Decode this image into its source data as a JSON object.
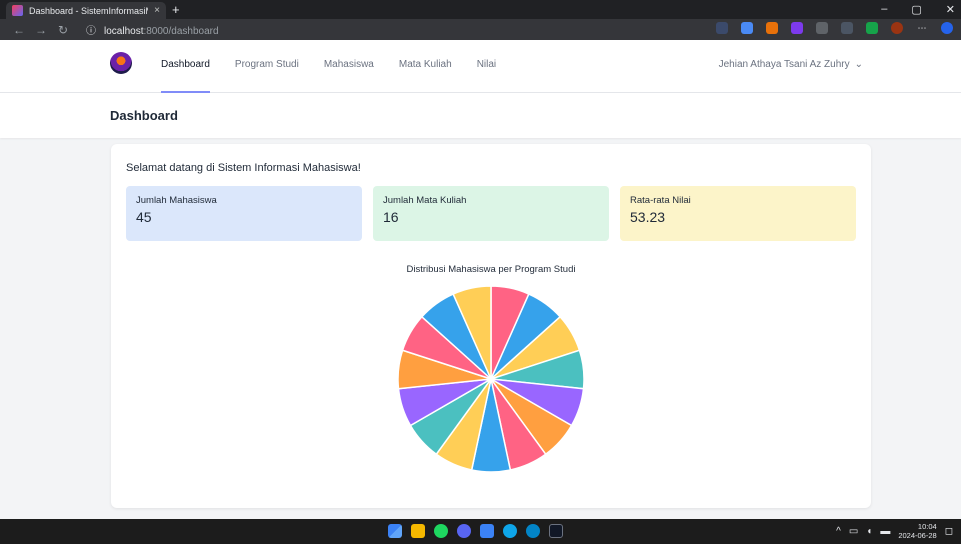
{
  "browser": {
    "tab_title": "Dashboard - SistemInformasiMa",
    "tab_close": "×",
    "new_tab": "+",
    "url_host": "localhost",
    "url_path": ":8000/dashboard",
    "win_min": "–",
    "win_max": "▢",
    "win_close": "✕"
  },
  "navbar": {
    "links": [
      "Dashboard",
      "Program Studi",
      "Mahasiswa",
      "Mata Kuliah",
      "Nilai"
    ],
    "user_name": "Jehian Athaya Tsani Az Zuhry"
  },
  "header": {
    "title": "Dashboard"
  },
  "main": {
    "welcome": "Selamat datang di Sistem Informasi Mahasiswa!",
    "stats": [
      {
        "label": "Jumlah Mahasiswa",
        "value": "45"
      },
      {
        "label": "Jumlah Mata Kuliah",
        "value": "16"
      },
      {
        "label": "Rata-rata Nilai",
        "value": "53.23"
      }
    ]
  },
  "chart_data": {
    "type": "pie",
    "title": "Distribusi Mahasiswa per Program Studi",
    "values": [
      3,
      3,
      3,
      3,
      3,
      3,
      3,
      3,
      3,
      3,
      3,
      3,
      3,
      3,
      3
    ],
    "colors": [
      "#ff6384",
      "#36a2eb",
      "#ffce56",
      "#4bc0c0",
      "#9966ff",
      "#ff9f40",
      "#ff6384",
      "#36a2eb",
      "#ffce56",
      "#4bc0c0",
      "#9966ff",
      "#ff9f40",
      "#ff6384",
      "#36a2eb",
      "#ffce56"
    ]
  },
  "taskbar": {
    "time": "10:04",
    "date": "2024-06-28"
  }
}
